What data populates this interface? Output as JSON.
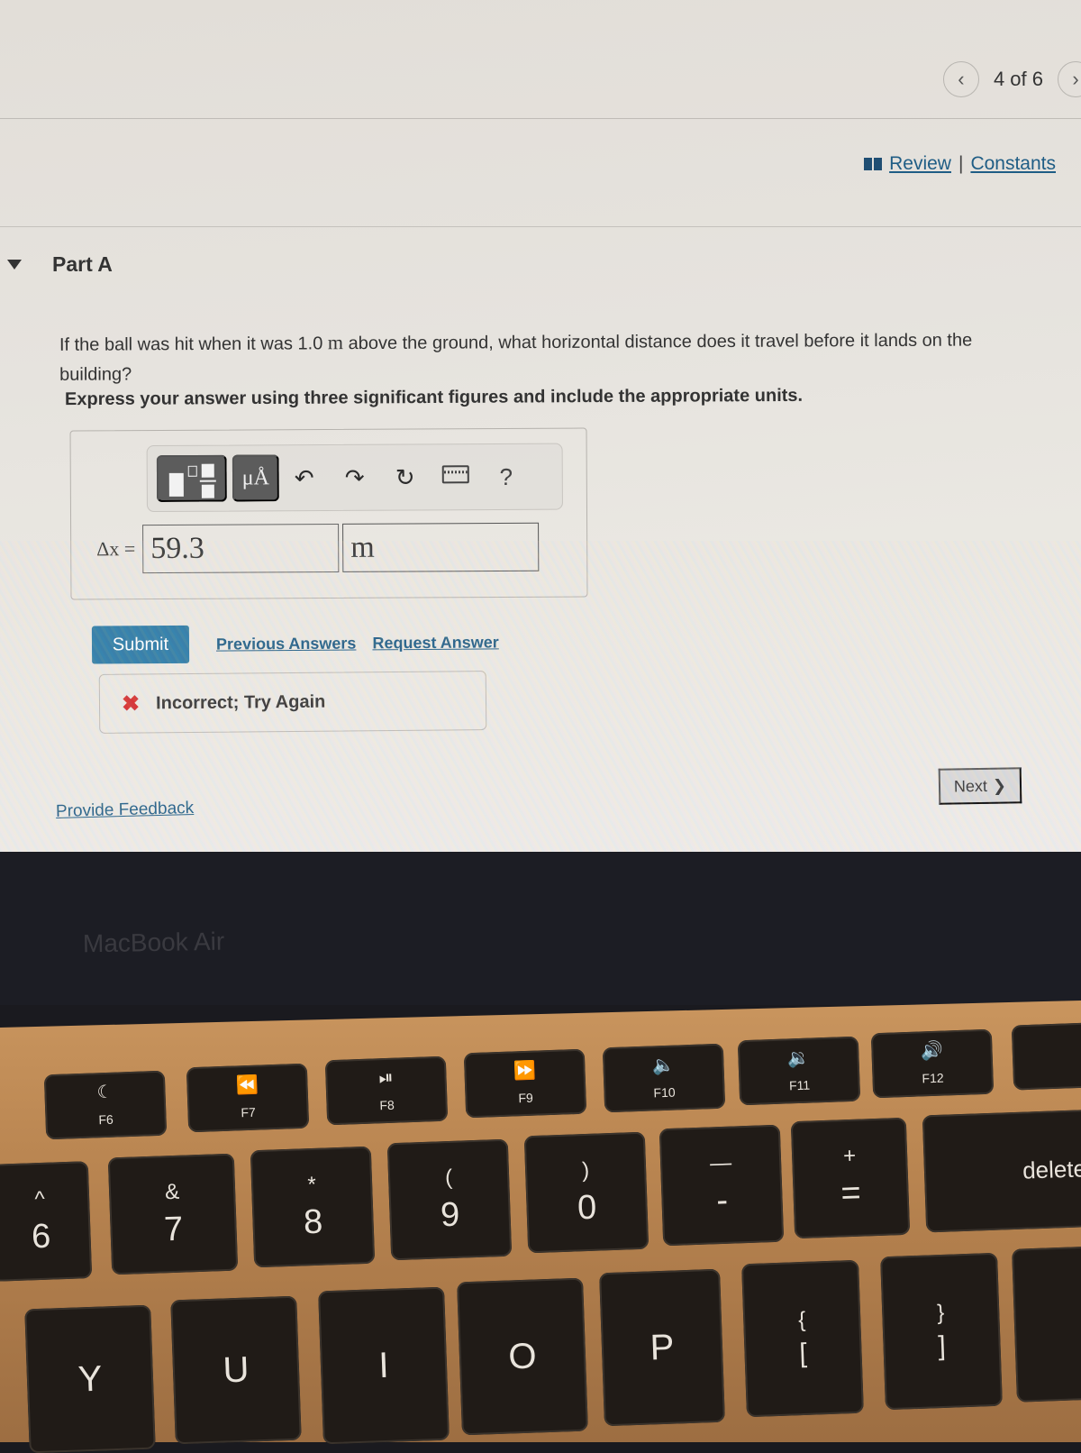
{
  "navigation": {
    "prev_icon": "chevron-left-icon",
    "prev_glyph": "‹",
    "page_count": "4 of 6",
    "next_icon": "chevron-right-icon",
    "next_glyph": "›"
  },
  "resources": {
    "book_icon": "book-icon",
    "review_label": "Review",
    "separator": "|",
    "constants_label": "Constants"
  },
  "part": {
    "title": "Part A",
    "question_pre": "If the ball was hit when it was 1.0 ",
    "question_unit": "m",
    "question_post": " above the ground, what horizontal distance does it travel before it lands on the building?",
    "instruction": "Express your answer using three significant figures and include the appropriate units."
  },
  "toolbar": {
    "templates_icon": "templates-icon",
    "units_label": "μÅ",
    "undo_glyph": "↶",
    "redo_glyph": "↷",
    "reset_glyph": "↻",
    "keyboard_icon": "keyboard-icon",
    "help_label": "?"
  },
  "answer": {
    "variable_label": "Δx =",
    "value": "59.3",
    "unit": "m"
  },
  "actions": {
    "submit_label": "Submit",
    "previous_answers_label": "Previous Answers",
    "request_answer_label": "Request Answer"
  },
  "feedback": {
    "status_icon": "x-icon",
    "status_glyph": "✖",
    "message": "Incorrect; Try Again",
    "status_color": "#d42c2c"
  },
  "footer": {
    "provide_feedback_label": "Provide Feedback",
    "next_label": "Next",
    "next_glyph": "❯"
  },
  "device": {
    "brand": "MacBook Air",
    "function_keys": [
      {
        "label": "F6",
        "glyph": "☾",
        "icon": "moon-icon"
      },
      {
        "label": "F7",
        "glyph": "⏪",
        "icon": "rewind-icon"
      },
      {
        "label": "F8",
        "glyph": "⏯",
        "icon": "play-pause-icon"
      },
      {
        "label": "F9",
        "glyph": "⏩",
        "icon": "fast-forward-icon"
      },
      {
        "label": "F10",
        "glyph": "🔈",
        "icon": "mute-icon"
      },
      {
        "label": "F11",
        "glyph": "🔉",
        "icon": "volume-down-icon"
      },
      {
        "label": "F12",
        "glyph": "🔊",
        "icon": "volume-up-icon"
      }
    ],
    "number_keys": [
      {
        "top": "^",
        "bottom": "6"
      },
      {
        "top": "&",
        "bottom": "7"
      },
      {
        "top": "*",
        "bottom": "8"
      },
      {
        "top": "(",
        "bottom": "9"
      },
      {
        "top": ")",
        "bottom": "0"
      },
      {
        "top": "—",
        "bottom": "-"
      },
      {
        "top": "+",
        "bottom": "="
      }
    ],
    "delete_label": "delete",
    "letter_keys": [
      "Y",
      "U",
      "I",
      "O",
      "P"
    ],
    "bracket_keys": [
      {
        "top": "{",
        "bottom": "["
      },
      {
        "top": "}",
        "bottom": "]"
      }
    ]
  }
}
